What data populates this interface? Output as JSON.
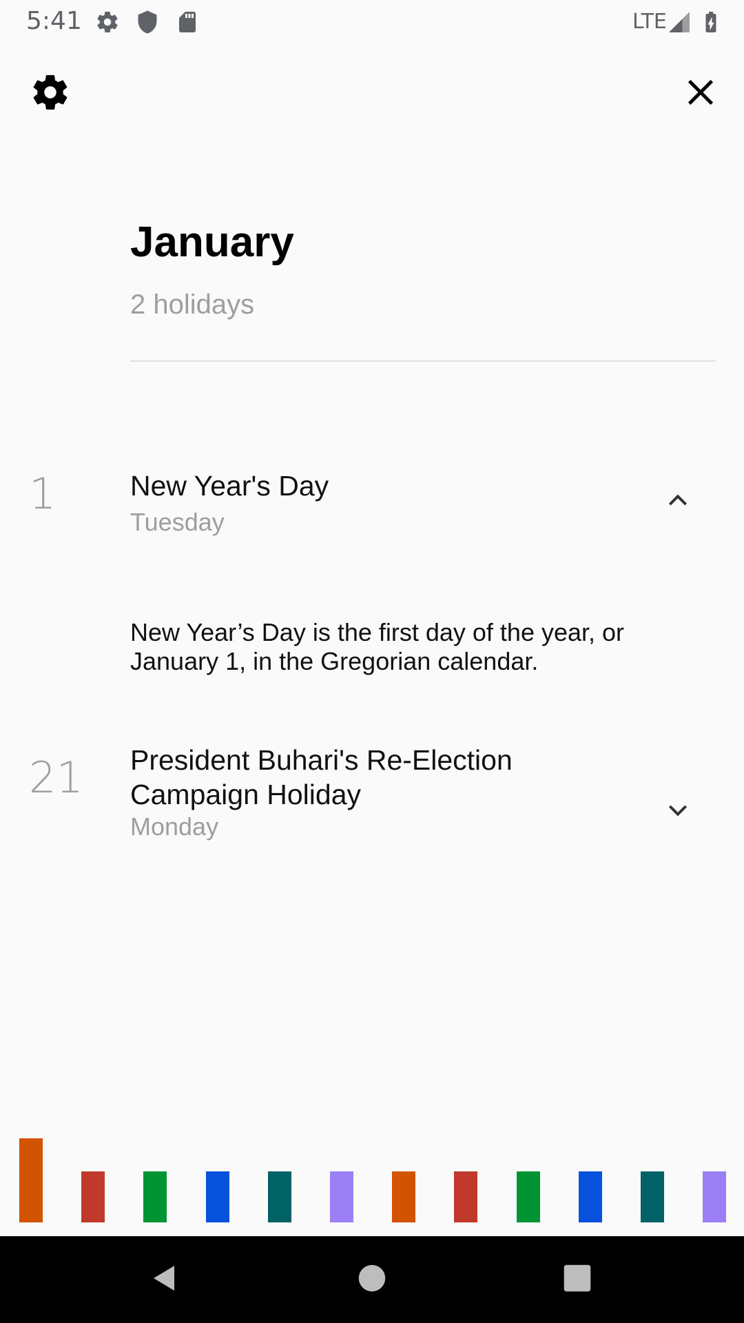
{
  "status_bar": {
    "time": "5:41",
    "network": "LTE",
    "icons": [
      "gear-icon",
      "shield-icon",
      "sd-card-icon",
      "signal-icon",
      "battery-charging-icon"
    ]
  },
  "toolbar": {
    "left_icon": "gear-icon",
    "right_icon": "close-icon"
  },
  "header": {
    "month": "January",
    "count_label": "2 holidays"
  },
  "holidays": [
    {
      "day": "1",
      "name": "New Year's Day",
      "weekday": "Tuesday",
      "expanded": true,
      "description": "New Year’s Day is the first day of the year, or January 1, in the Gregorian calendar."
    },
    {
      "day": "21",
      "name": "President Buhari's Re-Election Campaign Holiday",
      "weekday": "Monday",
      "expanded": false
    }
  ],
  "month_bars": {
    "selected_index": 0,
    "colors": [
      "#d35400",
      "#c0392b",
      "#009432",
      "#0652dd",
      "#006266",
      "#9b7ff5",
      "#d35400",
      "#c0392b",
      "#009432",
      "#0652dd",
      "#006266",
      "#9b7ff5"
    ]
  },
  "nav": {
    "buttons": [
      "back-icon",
      "home-icon",
      "recents-icon"
    ]
  }
}
